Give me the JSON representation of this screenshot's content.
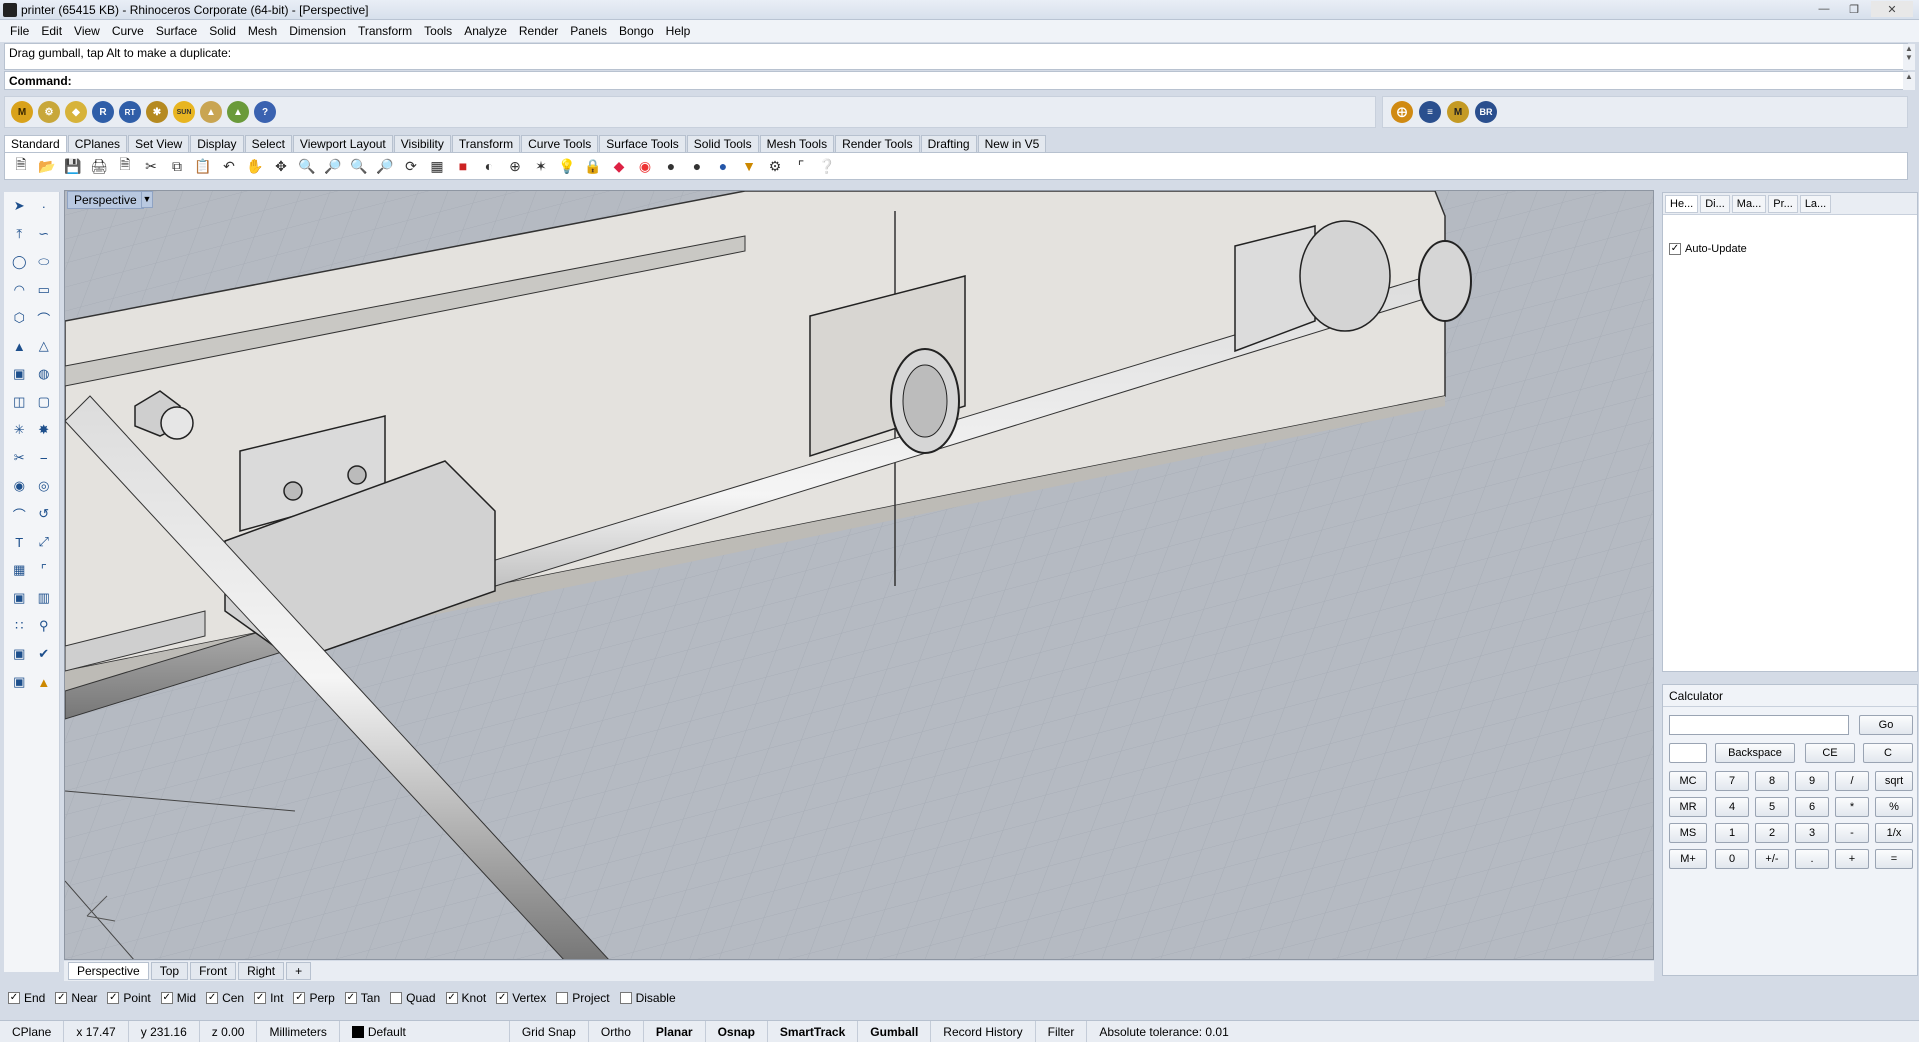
{
  "window": {
    "title": "printer (65415 KB) - Rhinoceros Corporate (64-bit) - [Perspective]"
  },
  "menu": [
    "File",
    "Edit",
    "View",
    "Curve",
    "Surface",
    "Solid",
    "Mesh",
    "Dimension",
    "Transform",
    "Tools",
    "Analyze",
    "Render",
    "Panels",
    "Bongo",
    "Help"
  ],
  "command": {
    "history": "Drag gumball, tap Alt to make a duplicate:",
    "prompt": "Command:"
  },
  "plugin_toolbar": {
    "left_labels": [
      "M",
      "RT",
      "SUN"
    ],
    "right_labels": [
      "BR"
    ]
  },
  "toolbar_tabs": [
    "Standard",
    "CPlanes",
    "Set View",
    "Display",
    "Select",
    "Viewport Layout",
    "Visibility",
    "Transform",
    "Curve Tools",
    "Surface Tools",
    "Solid Tools",
    "Mesh Tools",
    "Render Tools",
    "Drafting",
    "New in V5"
  ],
  "viewport": {
    "title": "Perspective"
  },
  "view_tabs": [
    "Perspective",
    "Top",
    "Front",
    "Right"
  ],
  "right_panel": {
    "tabs": [
      "He...",
      "Di...",
      "Ma...",
      "Pr...",
      "La..."
    ],
    "auto_update": "Auto-Update"
  },
  "calculator": {
    "title": "Calculator",
    "go": "Go",
    "backspace": "Backspace",
    "ce": "CE",
    "c": "C",
    "keys": [
      "MC",
      "7",
      "8",
      "9",
      "/",
      "sqrt",
      "MR",
      "4",
      "5",
      "6",
      "*",
      "%",
      "MS",
      "1",
      "2",
      "3",
      "-",
      "1/x",
      "M+",
      "0",
      "+/-",
      ".",
      "+",
      "="
    ]
  },
  "osnap": [
    {
      "label": "End",
      "checked": true
    },
    {
      "label": "Near",
      "checked": true
    },
    {
      "label": "Point",
      "checked": true
    },
    {
      "label": "Mid",
      "checked": true
    },
    {
      "label": "Cen",
      "checked": true
    },
    {
      "label": "Int",
      "checked": true
    },
    {
      "label": "Perp",
      "checked": true
    },
    {
      "label": "Tan",
      "checked": true
    },
    {
      "label": "Quad",
      "checked": false
    },
    {
      "label": "Knot",
      "checked": true
    },
    {
      "label": "Vertex",
      "checked": true
    },
    {
      "label": "Project",
      "checked": false
    },
    {
      "label": "Disable",
      "checked": false
    }
  ],
  "status": {
    "cplane": "CPlane",
    "x": "x 17.47",
    "y": "y 231.16",
    "z": "z 0.00",
    "units": "Millimeters",
    "layer": "Default",
    "grid_snap": "Grid Snap",
    "ortho": "Ortho",
    "planar": "Planar",
    "osnap": "Osnap",
    "smarttrack": "SmartTrack",
    "gumball": "Gumball",
    "record_history": "Record History",
    "filter": "Filter",
    "tolerance": "Absolute tolerance: 0.01"
  }
}
